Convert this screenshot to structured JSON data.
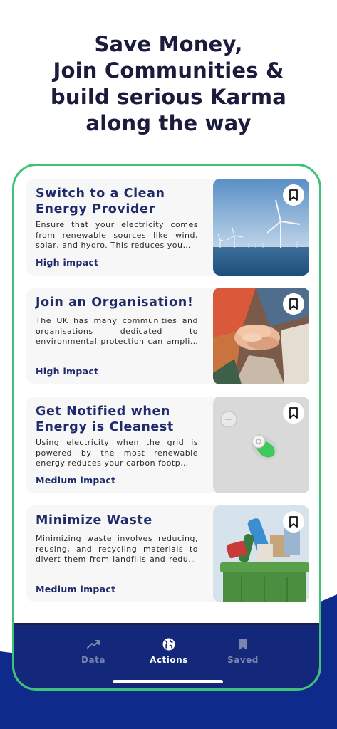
{
  "headline": {
    "line1": "Save Money,",
    "line2": "Join Communities &",
    "line3": "build serious Karma",
    "line4": "along the way"
  },
  "cards": [
    {
      "title": "Switch to a Clean Energy Provider",
      "description": "Ensure that your electricity comes from renewable sources like wind, solar, and hydro. This reduces you…",
      "impact": "High impact",
      "image": "wind-turbines-at-sea"
    },
    {
      "title": "Join an Organisation!",
      "description": "The UK has many communities and organisations dedicated to environmental protection can amplify your impact. You connect…",
      "impact": "High impact",
      "image": "stacked-hands"
    },
    {
      "title": "Get Notified when Energy is Cleanest",
      "description": "Using electricity when the grid is powered by the most renewable energy reduces your carbon footp…",
      "impact": "Medium impact",
      "image": "green-toggle-switch"
    },
    {
      "title": "Minimize Waste",
      "description": "Minimizing waste involves reducing, reusing, and recycling materials to divert them from landfills and reduce resource cons…",
      "impact": "Medium impact",
      "image": "recycling-bin"
    }
  ],
  "tabs": [
    {
      "label": "Data",
      "icon": "trending-up-icon",
      "active": false
    },
    {
      "label": "Actions",
      "icon": "globe-icon",
      "active": true
    },
    {
      "label": "Saved",
      "icon": "bookmark-icon",
      "active": false
    }
  ],
  "colors": {
    "headline": "#1b1c3d",
    "card_title": "#1f2b6b",
    "phone_border": "#3ec27a",
    "tabbar": "#13287a",
    "wave": "#0e2a8a"
  }
}
